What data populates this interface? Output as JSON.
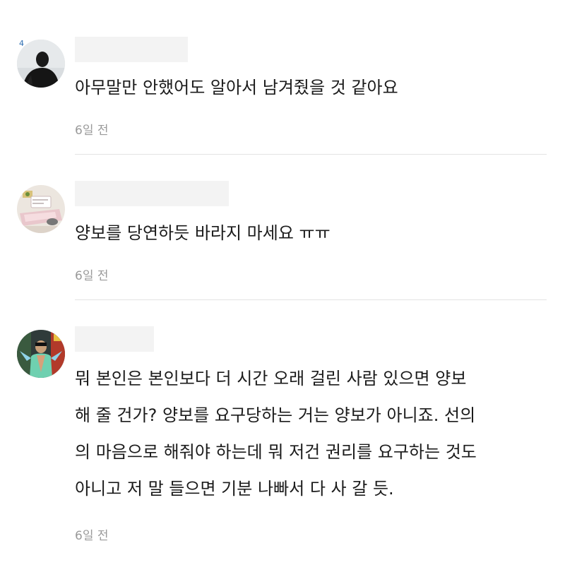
{
  "comments": [
    {
      "text": "아무말만 안했어도 알아서 남겨줬을 것 같아요",
      "time": "6일 전",
      "avatar_icon": "dark-silhouette-profile-image",
      "avatar_badge": "4"
    },
    {
      "text": "양보를 당연하듯 바라지 마세요 ㅠㅠ",
      "time": "6일 전",
      "avatar_icon": "cartoon-bed-profile-image"
    },
    {
      "text": "뭐 본인은 본인보다 더 시간 오래 걸린 사람 있으면 양보\n해 줄 건가? 양보를 요구당하는 거는 양보가 아니죠. 선의\n의 마음으로 해줘야 하는데 뭐 저건 권리를 요구하는 것도\n아니고 저 말 들으면 기분 나빠서 다 사 갈 듯.",
      "time": "6일 전",
      "avatar_icon": "colorful-dancer-profile-image"
    }
  ],
  "colors": {
    "text": "#1b1b1b",
    "time": "#9a9a9a",
    "divider": "#e4e4e4",
    "name_placeholder": "#f3f3f3"
  }
}
